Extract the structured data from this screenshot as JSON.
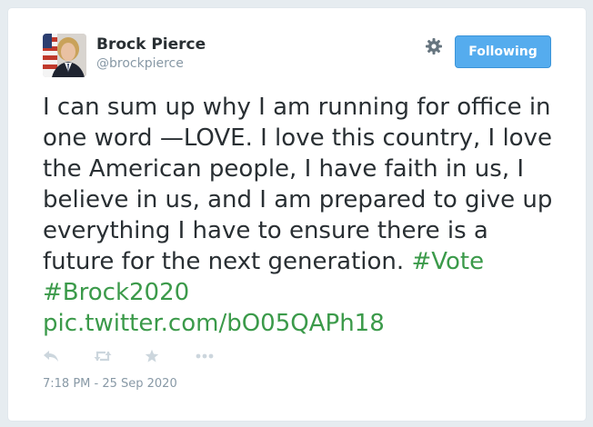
{
  "user": {
    "name": "Brock Pierce",
    "handle": "@brockpierce",
    "avatar_icon": "profile-photo-flag"
  },
  "follow_button": {
    "label": "Following"
  },
  "tweet": {
    "text": "I can sum up why I am running for office in one word —LOVE. I love this country, I love the American people, I have faith in us, I believe in us, and I am prepared to give up everything I have to ensure there is a future for the next generation.",
    "hashtag_1": "#Vote",
    "hashtag_2": "#Brock2020",
    "link": "pic.twitter.com/bO05QAPh18"
  },
  "actions": [
    "reply-icon",
    "retweet-icon",
    "favorite-icon",
    "more-icon"
  ],
  "timestamp": "7:18 PM - 25 Sep 2020",
  "colors": {
    "link": "#3b9a4a",
    "follow_button": "#55acee",
    "text": "#292f33",
    "muted": "#8899a6"
  }
}
